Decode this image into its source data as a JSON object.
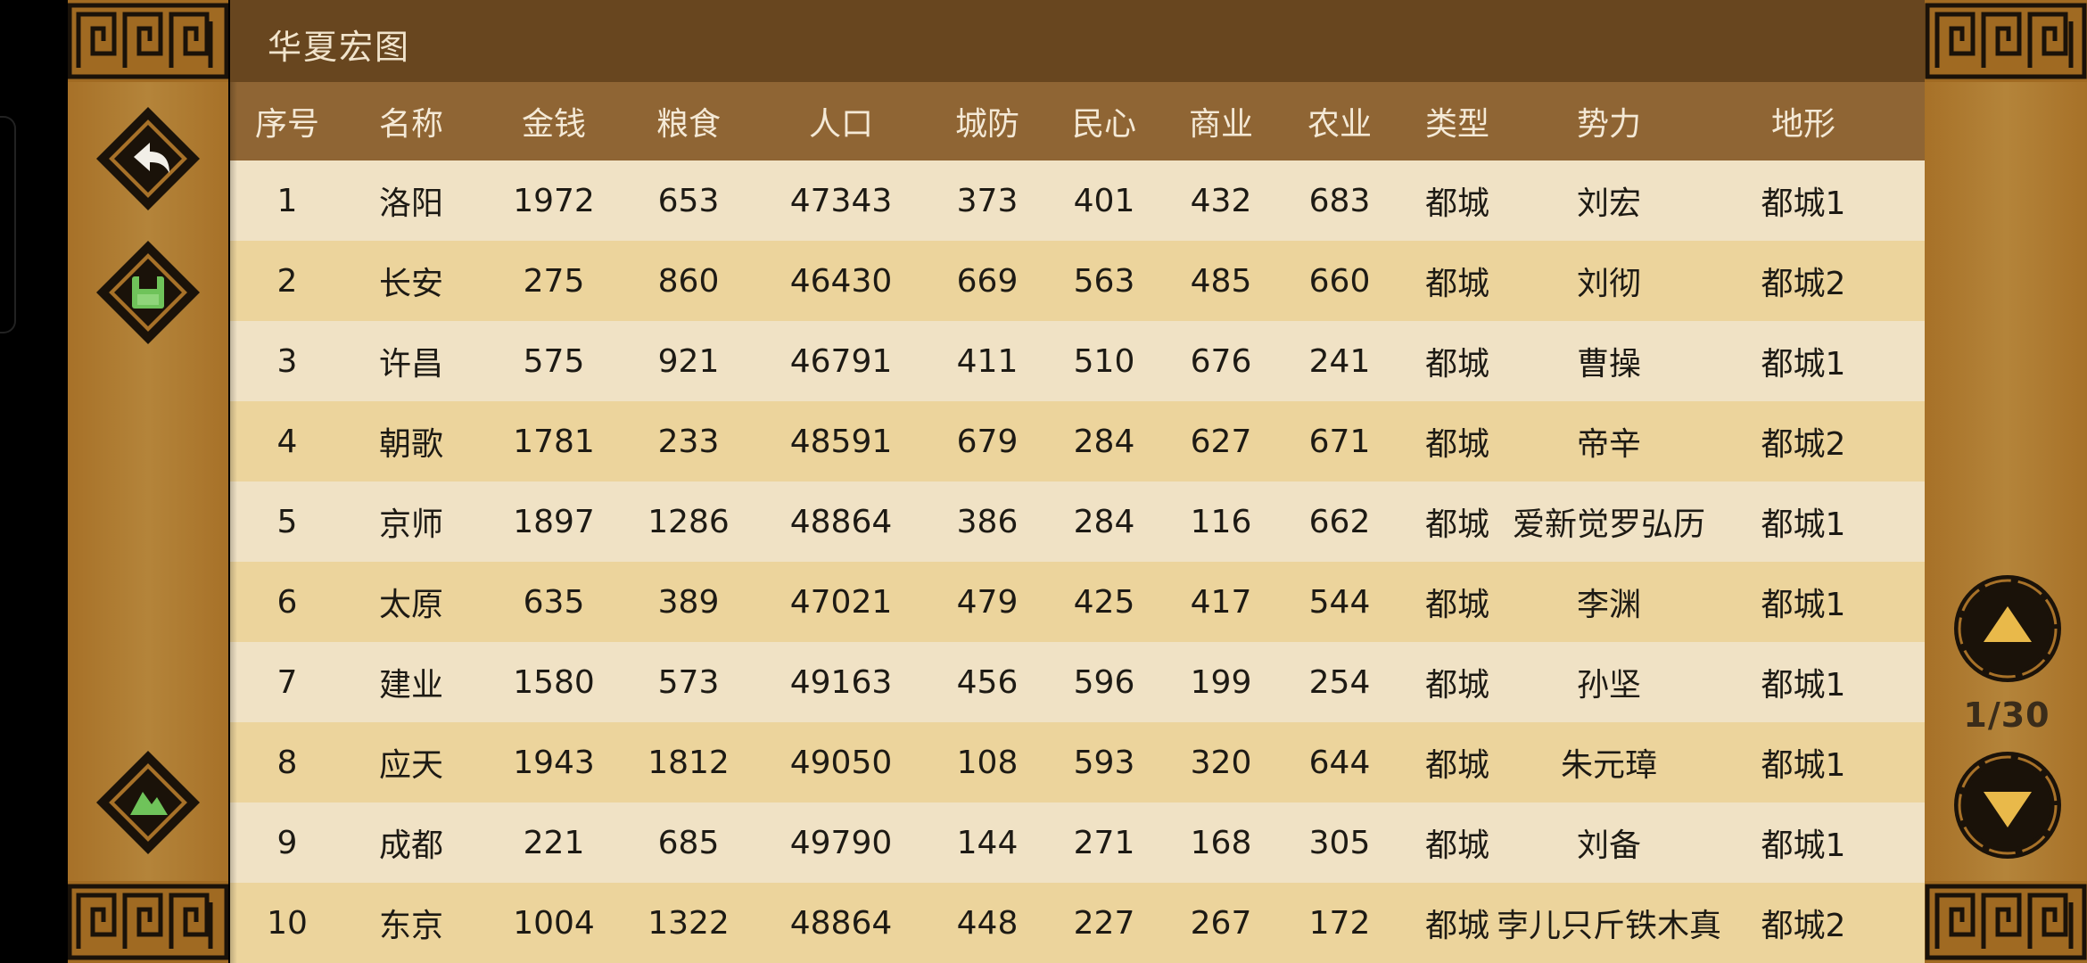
{
  "title": "华夏宏图",
  "headers": [
    "序号",
    "名称",
    "金钱",
    "粮食",
    "人口",
    "城防",
    "民心",
    "商业",
    "农业",
    "类型",
    "势力",
    "地形"
  ],
  "rows": [
    [
      "1",
      "洛阳",
      "1972",
      "653",
      "47343",
      "373",
      "401",
      "432",
      "683",
      "都城",
      "刘宏",
      "都城1"
    ],
    [
      "2",
      "长安",
      "275",
      "860",
      "46430",
      "669",
      "563",
      "485",
      "660",
      "都城",
      "刘彻",
      "都城2"
    ],
    [
      "3",
      "许昌",
      "575",
      "921",
      "46791",
      "411",
      "510",
      "676",
      "241",
      "都城",
      "曹操",
      "都城1"
    ],
    [
      "4",
      "朝歌",
      "1781",
      "233",
      "48591",
      "679",
      "284",
      "627",
      "671",
      "都城",
      "帝辛",
      "都城2"
    ],
    [
      "5",
      "京师",
      "1897",
      "1286",
      "48864",
      "386",
      "284",
      "116",
      "662",
      "都城",
      "爱新觉罗弘历",
      "都城1"
    ],
    [
      "6",
      "太原",
      "635",
      "389",
      "47021",
      "479",
      "425",
      "417",
      "544",
      "都城",
      "李渊",
      "都城1"
    ],
    [
      "7",
      "建业",
      "1580",
      "573",
      "49163",
      "456",
      "596",
      "199",
      "254",
      "都城",
      "孙坚",
      "都城1"
    ],
    [
      "8",
      "应天",
      "1943",
      "1812",
      "49050",
      "108",
      "593",
      "320",
      "644",
      "都城",
      "朱元璋",
      "都城1"
    ],
    [
      "9",
      "成都",
      "221",
      "685",
      "49790",
      "144",
      "271",
      "168",
      "305",
      "都城",
      "刘备",
      "都城1"
    ],
    [
      "10",
      "东京",
      "1004",
      "1322",
      "48864",
      "448",
      "227",
      "267",
      "172",
      "都城",
      "孛儿只斤铁木真",
      "都城2"
    ]
  ],
  "pagination": {
    "current_page": 1,
    "total_pages": 30,
    "label": "1/30"
  },
  "icons": {
    "back": "back-arrow-icon",
    "save": "save-icon",
    "map": "mountain-icon",
    "page_up": "triangle-up-icon",
    "page_down": "triangle-down-icon"
  },
  "colors": {
    "title_bar": "#68461f",
    "header_row": "#8f6534",
    "row_light": "#f0e2c5",
    "row_dark": "#ecd49c",
    "side_panel": "#a77128",
    "button_accent": "#e9b94a",
    "button_green": "#6fc35a"
  }
}
